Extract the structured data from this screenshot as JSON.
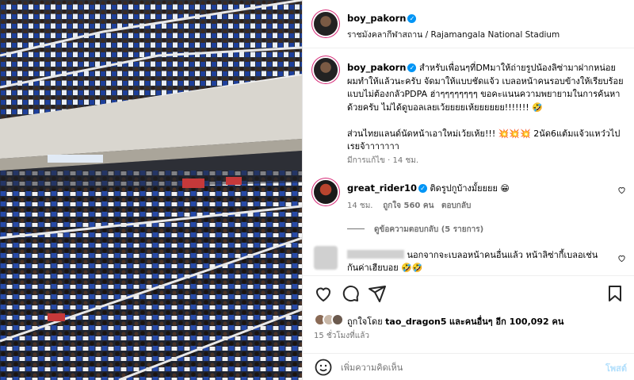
{
  "post": {
    "author": "boy_pakorn",
    "location": "ราชมังคลากีฬาสถาน / Rajamangala National Stadium",
    "caption": "สำหรับเพื่อนๆที่DMมาให้ถ่ายรูปน้องลิซ่ามาฝากหน่อย ผมทำให้แล้วนะครับ จัดมาให้แบบชัดแจ้ว เบลอหน้าคนรอบข้างให้เรียบร้อยแบบไม่ต้องกลัวPDPA ฮ่าๆๆๆๆๆๆๆๆ ขอคะแนนความพยายามในการค้นหาด้วยครับ ไม่ได้ดูบอลเลยเว้ยยยยเห้ยยยยยย!!!!!!! 🤣\n\nส่วนไทยแลนด์นัดหน้าเอาใหม่เว้ยเห้ย!!! 💥💥💥 2นัด6แต้มแจ้วแหว๋วไปเรยจ้าาาาาาา",
    "caption_meta": "มีการแก้ไข · 14 ชม."
  },
  "comments": [
    {
      "user": "great_rider10",
      "text": "ติดรูปกูบ้างมั้ยยยย 😁",
      "meta": [
        "14 ชม.",
        "ถูกใจ 560 คน",
        "ตอบกลับ"
      ],
      "view_replies": "ดูข้อความตอบกลับ (5 รายการ)"
    },
    {
      "user": "",
      "text": "นอกจากจะเบลอหน้าคนอื่นแล้ว หน้าลิซ่ากี้เบลอเช่นกันค่าเฮียบอย 🤣🤣"
    }
  ],
  "likes": {
    "prefix": "ถูกใจโดย",
    "user": "tao_dragon5",
    "suffix": "และคนอื่นๆ อีก 100,092 คน"
  },
  "timestamp": "15 ชั่วโมงที่แล้ว",
  "footer": {
    "placeholder": "เพิ่มความคิดเห็น",
    "post_label": "โพสต์"
  },
  "icons": [
    "more-icon",
    "heart-icon",
    "comment-icon",
    "share-icon",
    "bookmark-icon",
    "emoji-icon"
  ],
  "colors": {
    "verified": "#0095f6",
    "muted": "#737373",
    "post_button": "#b2dffc"
  }
}
